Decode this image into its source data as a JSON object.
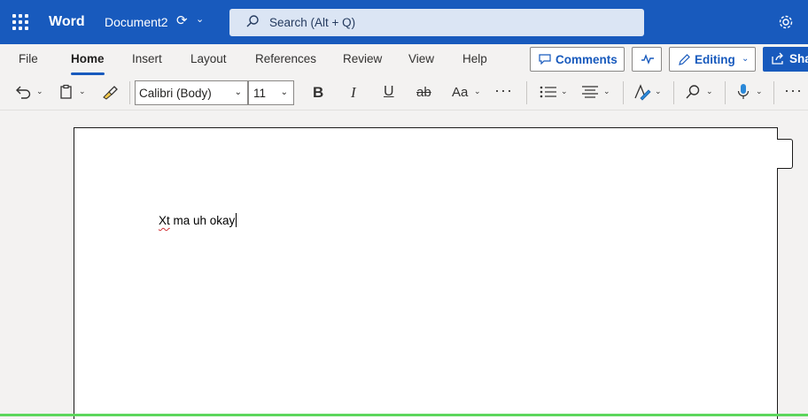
{
  "app": {
    "name": "Word",
    "document_name": "Document2"
  },
  "search": {
    "placeholder": "Search (Alt + Q)"
  },
  "ribbon_tabs": [
    "File",
    "Home",
    "Insert",
    "Layout",
    "References",
    "Review",
    "View",
    "Help"
  ],
  "active_tab": "Home",
  "actions": {
    "comments_label": "Comments",
    "editing_label": "Editing",
    "share_label": "Sha"
  },
  "format": {
    "font_name": "Calibri (Body)",
    "font_size": "11",
    "bold": "B",
    "italic": "I",
    "underline": "U",
    "strikethrough": "ab",
    "font_case": "Aa"
  },
  "document": {
    "misspelled_word": "Xt",
    "rest_text": " ma uh okay"
  },
  "colors": {
    "brand": "#185abd",
    "search_bg": "#dbe5f4",
    "spell_error": "#d13438"
  }
}
